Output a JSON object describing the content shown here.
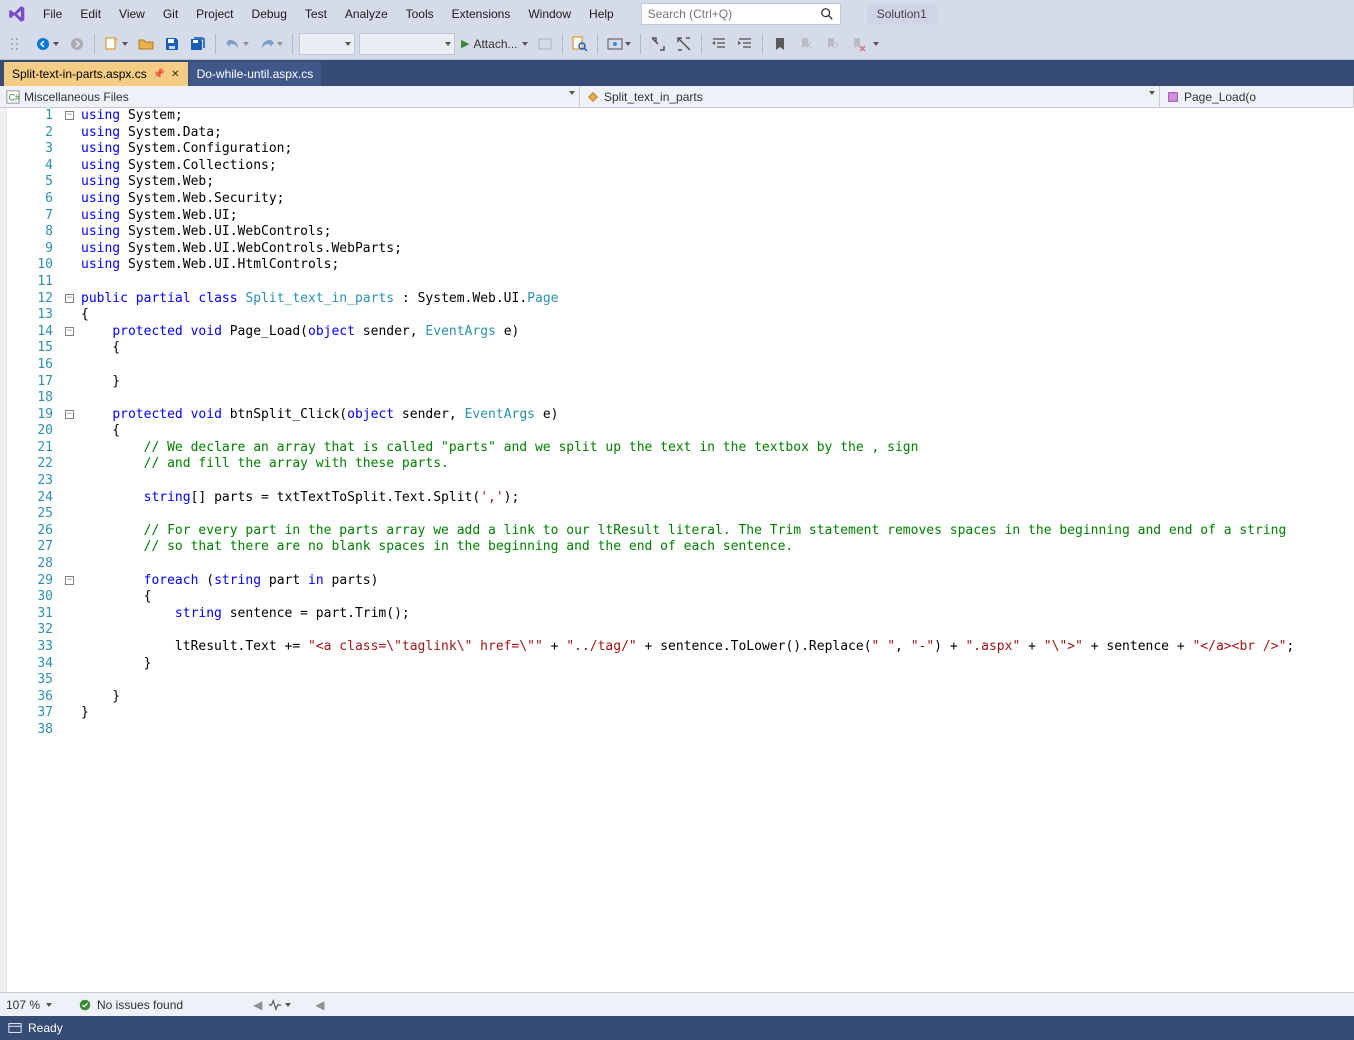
{
  "menu": {
    "items": [
      "File",
      "Edit",
      "View",
      "Git",
      "Project",
      "Debug",
      "Test",
      "Analyze",
      "Tools",
      "Extensions",
      "Window",
      "Help"
    ]
  },
  "search": {
    "placeholder": "Search (Ctrl+Q)"
  },
  "solution": {
    "label": "Solution1"
  },
  "toolbar": {
    "attach_label": "Attach..."
  },
  "tabs": {
    "active": "Split-text-in-parts.aspx.cs",
    "inactive": "Do-while-until.aspx.cs"
  },
  "navbar": {
    "scope": "Miscellaneous Files",
    "class": "Split_text_in_parts",
    "member": "Page_Load(o"
  },
  "code": {
    "lines": [
      {
        "n": 1,
        "tokens": [
          [
            "k",
            "using"
          ],
          [
            "n",
            " System;"
          ]
        ]
      },
      {
        "n": 2,
        "tokens": [
          [
            "k",
            "using"
          ],
          [
            "n",
            " System.Data;"
          ]
        ]
      },
      {
        "n": 3,
        "tokens": [
          [
            "k",
            "using"
          ],
          [
            "n",
            " System.Configuration;"
          ]
        ]
      },
      {
        "n": 4,
        "tokens": [
          [
            "k",
            "using"
          ],
          [
            "n",
            " System.Collections;"
          ]
        ]
      },
      {
        "n": 5,
        "tokens": [
          [
            "k",
            "using"
          ],
          [
            "n",
            " System.Web;"
          ]
        ]
      },
      {
        "n": 6,
        "tokens": [
          [
            "k",
            "using"
          ],
          [
            "n",
            " System.Web.Security;"
          ]
        ]
      },
      {
        "n": 7,
        "tokens": [
          [
            "k",
            "using"
          ],
          [
            "n",
            " System.Web.UI;"
          ]
        ]
      },
      {
        "n": 8,
        "tokens": [
          [
            "k",
            "using"
          ],
          [
            "n",
            " System.Web.UI.WebControls;"
          ]
        ]
      },
      {
        "n": 9,
        "tokens": [
          [
            "k",
            "using"
          ],
          [
            "n",
            " System.Web.UI.WebControls.WebParts;"
          ]
        ]
      },
      {
        "n": 10,
        "tokens": [
          [
            "k",
            "using"
          ],
          [
            "n",
            " System.Web.UI.HtmlControls;"
          ]
        ]
      },
      {
        "n": 11,
        "tokens": []
      },
      {
        "n": 12,
        "tokens": [
          [
            "k",
            "public"
          ],
          [
            "n",
            " "
          ],
          [
            "k",
            "partial"
          ],
          [
            "n",
            " "
          ],
          [
            "k",
            "class"
          ],
          [
            "n",
            " "
          ],
          [
            "t",
            "Split_text_in_parts"
          ],
          [
            "n",
            " : System.Web.UI."
          ],
          [
            "t",
            "Page"
          ]
        ]
      },
      {
        "n": 13,
        "tokens": [
          [
            "n",
            "{"
          ]
        ]
      },
      {
        "n": 14,
        "tokens": [
          [
            "n",
            "    "
          ],
          [
            "k",
            "protected"
          ],
          [
            "n",
            " "
          ],
          [
            "k",
            "void"
          ],
          [
            "n",
            " Page_Load("
          ],
          [
            "k",
            "object"
          ],
          [
            "n",
            " sender, "
          ],
          [
            "t",
            "EventArgs"
          ],
          [
            "n",
            " e)"
          ]
        ]
      },
      {
        "n": 15,
        "tokens": [
          [
            "n",
            "    {"
          ]
        ]
      },
      {
        "n": 16,
        "tokens": []
      },
      {
        "n": 17,
        "tokens": [
          [
            "n",
            "    }"
          ]
        ]
      },
      {
        "n": 18,
        "tokens": []
      },
      {
        "n": 19,
        "tokens": [
          [
            "n",
            "    "
          ],
          [
            "k",
            "protected"
          ],
          [
            "n",
            " "
          ],
          [
            "k",
            "void"
          ],
          [
            "n",
            " btnSplit_Click("
          ],
          [
            "k",
            "object"
          ],
          [
            "n",
            " sender, "
          ],
          [
            "t",
            "EventArgs"
          ],
          [
            "n",
            " e)"
          ]
        ]
      },
      {
        "n": 20,
        "tokens": [
          [
            "n",
            "    {"
          ]
        ]
      },
      {
        "n": 21,
        "tokens": [
          [
            "n",
            "        "
          ],
          [
            "c",
            "// We declare an array that is called \"parts\" and we split up the text in the textbox by the , sign"
          ]
        ]
      },
      {
        "n": 22,
        "tokens": [
          [
            "n",
            "        "
          ],
          [
            "c",
            "// and fill the array with these parts."
          ]
        ]
      },
      {
        "n": 23,
        "tokens": []
      },
      {
        "n": 24,
        "tokens": [
          [
            "n",
            "        "
          ],
          [
            "k",
            "string"
          ],
          [
            "n",
            "[] parts = txtTextToSplit.Text.Split("
          ],
          [
            "s",
            "','"
          ],
          [
            "n",
            ");"
          ]
        ]
      },
      {
        "n": 25,
        "tokens": []
      },
      {
        "n": 26,
        "tokens": [
          [
            "n",
            "        "
          ],
          [
            "c",
            "// For every part in the parts array we add a link to our ltResult literal. The Trim statement removes spaces in the beginning and end of a string"
          ]
        ]
      },
      {
        "n": 27,
        "tokens": [
          [
            "n",
            "        "
          ],
          [
            "c",
            "// so that there are no blank spaces in the beginning and the end of each sentence."
          ]
        ]
      },
      {
        "n": 28,
        "tokens": []
      },
      {
        "n": 29,
        "tokens": [
          [
            "n",
            "        "
          ],
          [
            "k",
            "foreach"
          ],
          [
            "n",
            " ("
          ],
          [
            "k",
            "string"
          ],
          [
            "n",
            " part "
          ],
          [
            "k",
            "in"
          ],
          [
            "n",
            " parts)"
          ]
        ]
      },
      {
        "n": 30,
        "tokens": [
          [
            "n",
            "        {"
          ]
        ]
      },
      {
        "n": 31,
        "tokens": [
          [
            "n",
            "            "
          ],
          [
            "k",
            "string"
          ],
          [
            "n",
            " sentence = part.Trim();"
          ]
        ]
      },
      {
        "n": 32,
        "tokens": []
      },
      {
        "n": 33,
        "tokens": [
          [
            "n",
            "            ltResult.Text += "
          ],
          [
            "s",
            "\"<a class=\\\"taglink\\\" href=\\\"\""
          ],
          [
            "n",
            " + "
          ],
          [
            "s",
            "\"../tag/\""
          ],
          [
            "n",
            " + sentence.ToLower().Replace("
          ],
          [
            "s",
            "\" \""
          ],
          [
            "n",
            ", "
          ],
          [
            "s",
            "\"-\""
          ],
          [
            "n",
            ") + "
          ],
          [
            "s",
            "\".aspx\""
          ],
          [
            "n",
            " + "
          ],
          [
            "s",
            "\"\\\">\""
          ],
          [
            "n",
            " + sentence + "
          ],
          [
            "s",
            "\"</a><br />\""
          ],
          [
            "n",
            ";"
          ]
        ]
      },
      {
        "n": 34,
        "tokens": [
          [
            "n",
            "        }"
          ]
        ]
      },
      {
        "n": 35,
        "tokens": []
      },
      {
        "n": 36,
        "tokens": [
          [
            "n",
            "    }"
          ]
        ]
      },
      {
        "n": 37,
        "tokens": [
          [
            "n",
            "}"
          ]
        ]
      },
      {
        "n": 38,
        "tokens": []
      }
    ],
    "fold_marks": [
      1,
      12,
      14,
      19,
      29
    ]
  },
  "bottombar": {
    "zoom": "107 %",
    "issues": "No issues found"
  },
  "status": {
    "text": "Ready"
  }
}
